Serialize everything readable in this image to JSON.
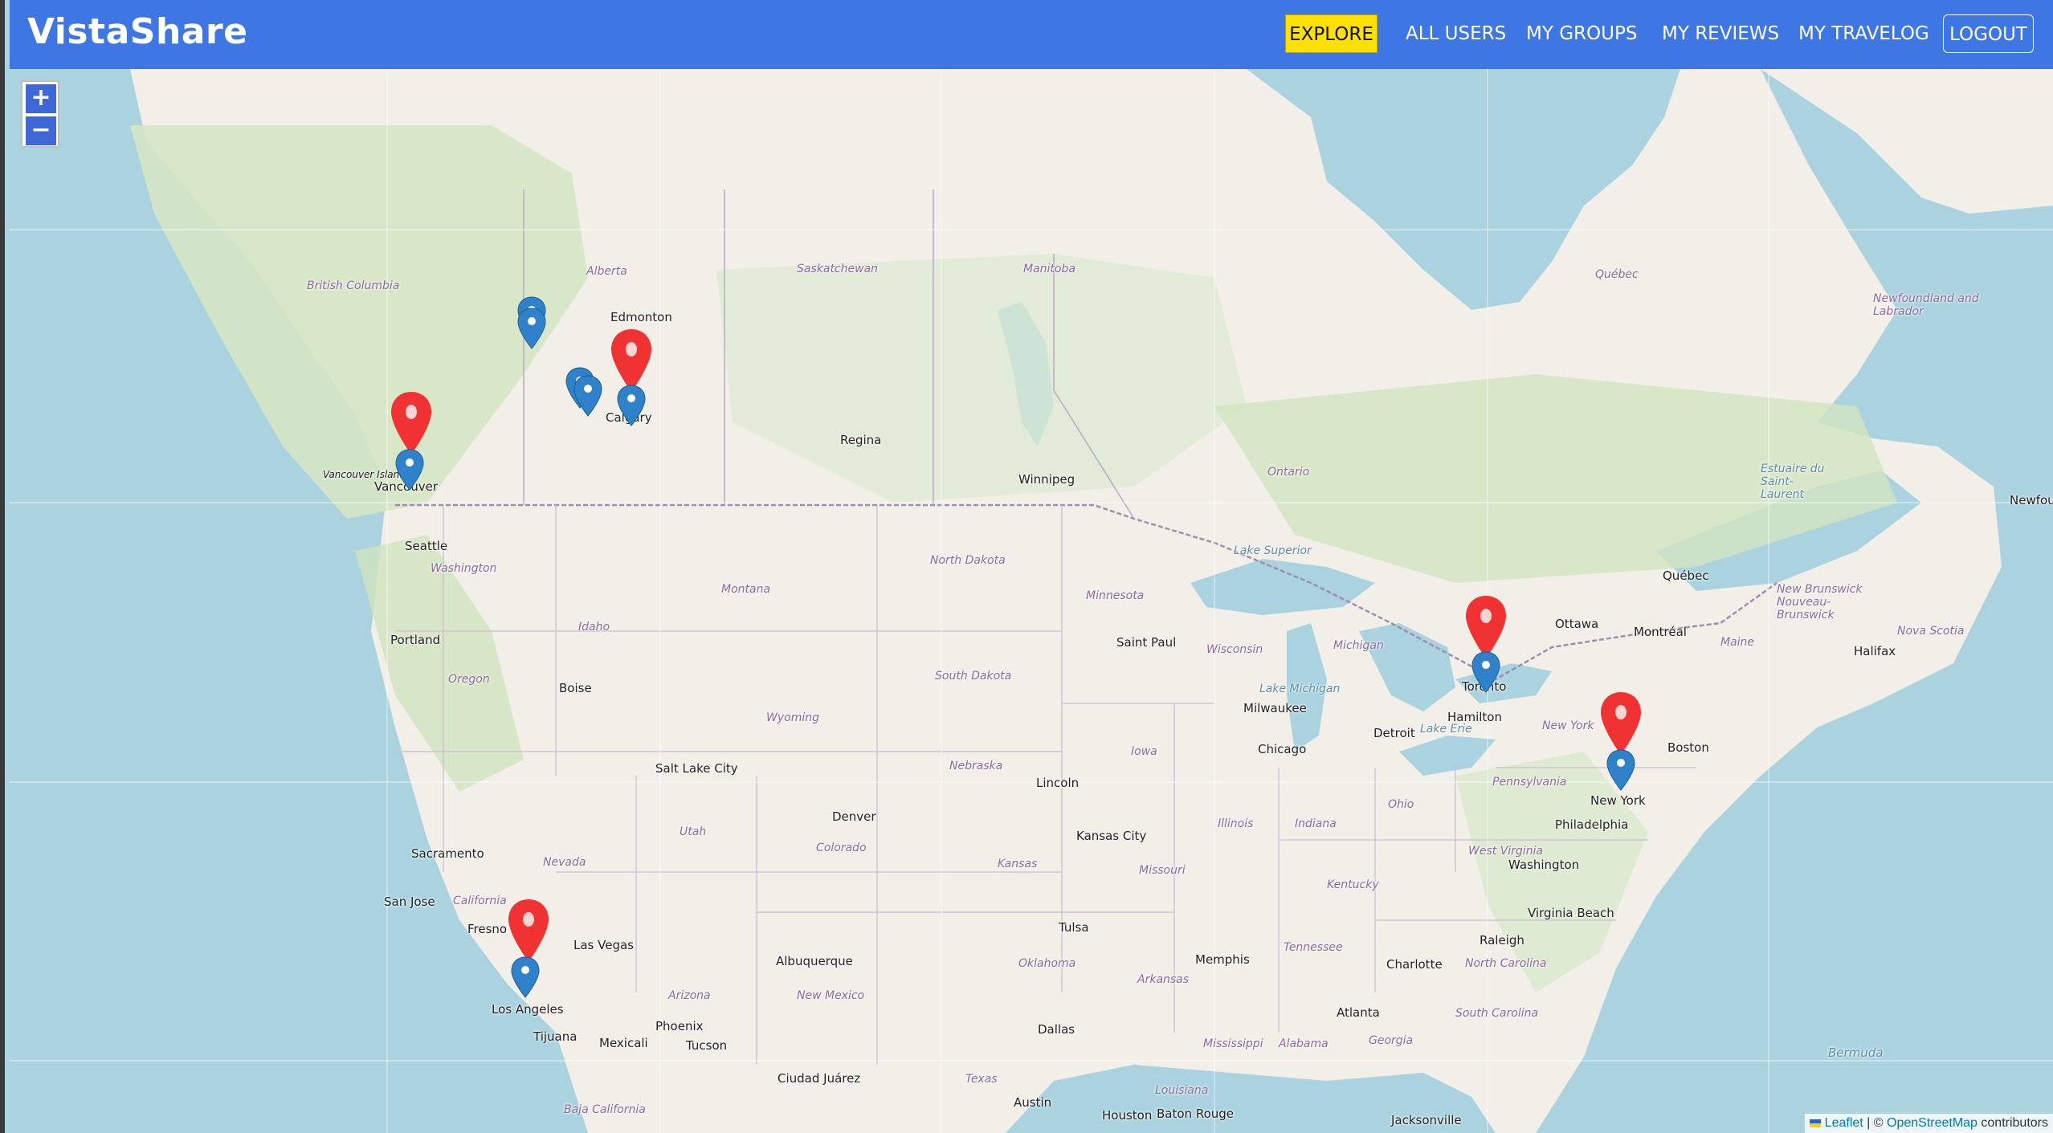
{
  "brand": "VistaShare",
  "nav": {
    "explore": "EXPLORE",
    "all_users": "ALL USERS",
    "my_groups": "MY GROUPS",
    "my_reviews": "MY REVIEWS",
    "my_travelog": "MY TRAVELOG",
    "logout": "LOGOUT"
  },
  "zoom": {
    "in": "+",
    "out": "−"
  },
  "attribution": {
    "leaflet": "Leaflet",
    "sep": " | © ",
    "osm": "OpenStreetMap",
    "tail": " contributors"
  },
  "colors": {
    "navbar": "#3e77e4",
    "explore_active": "#fde100",
    "water": "#aad3df",
    "land": "#f2efe9",
    "marker_red": "#f03232",
    "marker_blue": "#2f82c9"
  },
  "map_labels": {
    "cities": {
      "edmonton": "Edmonton",
      "calgary": "Calgary",
      "regina": "Regina",
      "winnipeg": "Winnipeg",
      "vancouver": "Vancouver",
      "vancouver_island": "Vancouver Island",
      "seattle": "Seattle",
      "portland": "Portland",
      "boise": "Boise",
      "salt_lake_city": "Salt Lake City",
      "denver": "Denver",
      "sacramento": "Sacramento",
      "san_jose": "San Jose",
      "fresno": "Fresno",
      "las_vegas": "Las Vegas",
      "los_angeles": "Los Angeles",
      "tijuana": "Tijuana",
      "mexicali": "Mexicali",
      "phoenix": "Phoenix",
      "tucson": "Tucson",
      "albuquerque": "Albuquerque",
      "ciudad_juarez": "Ciudad Juárez",
      "saint_paul": "Saint Paul",
      "lincoln": "Lincoln",
      "kansas_city": "Kansas City",
      "tulsa": "Tulsa",
      "dallas": "Dallas",
      "austin": "Austin",
      "houston": "Houston",
      "baton_rouge": "Baton Rouge",
      "memphis": "Memphis",
      "milwaukee": "Milwaukee",
      "chicago": "Chicago",
      "detroit": "Detroit",
      "toronto": "Toronto",
      "hamilton": "Hamilton",
      "ottawa": "Ottawa",
      "montreal": "Montréal",
      "quebec_city": "Québec",
      "boston": "Boston",
      "new_york": "New York",
      "philadelphia": "Philadelphia",
      "washington": "Washington",
      "virginia_beach": "Virginia Beach",
      "raleigh": "Raleigh",
      "charlotte": "Charlotte",
      "atlanta": "Atlanta",
      "jacksonville": "Jacksonville",
      "halifax": "Halifax"
    },
    "regions": {
      "british_columbia": "British Columbia",
      "alberta": "Alberta",
      "saskatchewan": "Saskatchewan",
      "manitoba": "Manitoba",
      "ontario": "Ontario",
      "quebec": "Québec",
      "newfoundland": "Newfoundland and Labrador",
      "washington_state": "Washington",
      "oregon": "Oregon",
      "idaho": "Idaho",
      "montana": "Montana",
      "wyoming": "Wyoming",
      "nevada": "Nevada",
      "utah": "Utah",
      "colorado": "Colorado",
      "california": "California",
      "arizona": "Arizona",
      "new_mexico": "New Mexico",
      "north_dakota": "North Dakota",
      "south_dakota": "South Dakota",
      "nebraska": "Nebraska",
      "kansas": "Kansas",
      "oklahoma": "Oklahoma",
      "texas": "Texas",
      "minnesota": "Minnesota",
      "iowa": "Iowa",
      "missouri": "Missouri",
      "arkansas": "Arkansas",
      "louisiana": "Louisiana",
      "wisconsin": "Wisconsin",
      "illinois": "Illinois",
      "indiana": "Indiana",
      "michigan": "Michigan",
      "ohio": "Ohio",
      "kentucky": "Kentucky",
      "tennessee": "Tennessee",
      "mississippi": "Mississippi",
      "alabama": "Alabama",
      "georgia": "Georgia",
      "pennsylvania": "Pennsylvania",
      "new_york_state": "New York",
      "west_virginia": "West Virginia",
      "north_carolina": "North Carolina",
      "south_carolina": "South Carolina",
      "maine": "Maine",
      "new_brunswick": "New Brunswick Nouveau-Brunswick",
      "nova_scotia": "Nova Scotia",
      "estuaire": "Estuaire du Saint-Laurent",
      "lake_superior": "Lake Superior",
      "lake_michigan": "Lake Michigan",
      "lake_erie": "Lake Erie",
      "baja_california": "Baja California",
      "bermuda": "Bermuda",
      "newfound": "Newfound"
    }
  }
}
